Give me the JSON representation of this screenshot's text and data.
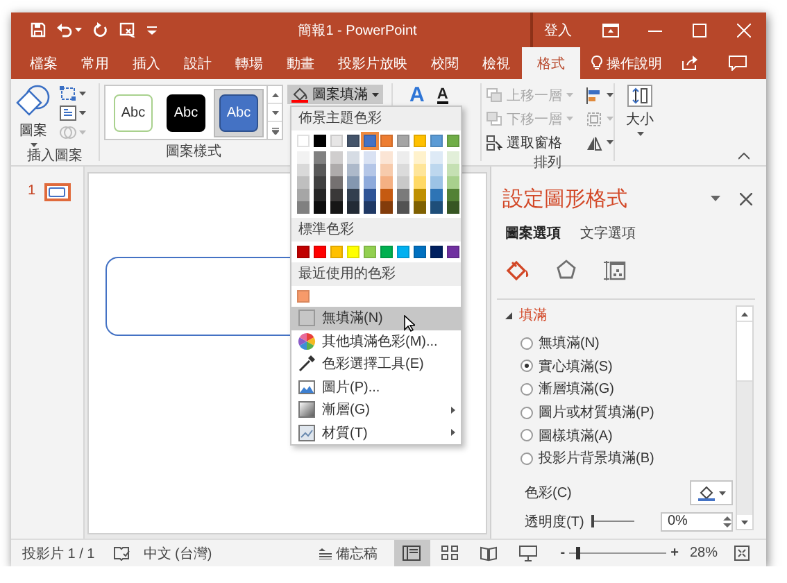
{
  "window": {
    "title": "簡報1 - PowerPoint",
    "sign_in": "登入"
  },
  "tabs": [
    {
      "label": "檔案",
      "selected": false
    },
    {
      "label": "常用",
      "selected": false
    },
    {
      "label": "插入",
      "selected": false
    },
    {
      "label": "設計",
      "selected": false
    },
    {
      "label": "轉場",
      "selected": false
    },
    {
      "label": "動畫",
      "selected": false
    },
    {
      "label": "投影片放映",
      "selected": false
    },
    {
      "label": "校閱",
      "selected": false
    },
    {
      "label": "檢視",
      "selected": false
    },
    {
      "label": "格式",
      "selected": true
    }
  ],
  "tell_me": "操作說明",
  "ribbon": {
    "insert_shapes": {
      "button": "圖案",
      "label": "插入圖案"
    },
    "shape_styles": {
      "label": "圖案樣式",
      "fill_button": "圖案填滿",
      "styles": [
        {
          "text": "Abc",
          "kind": "outline",
          "selected": false
        },
        {
          "text": "Abc",
          "kind": "dark",
          "selected": false
        },
        {
          "text": "Abc",
          "kind": "accent",
          "selected": true
        }
      ]
    },
    "wordart": {
      "quick_styles_glyph": "A",
      "text_fill_glyph": "A"
    },
    "arrange": {
      "label": "排列",
      "items": [
        {
          "label": "上移一層",
          "kind": "forward",
          "disabled": true
        },
        {
          "label": "下移一層",
          "kind": "backward",
          "disabled": true
        },
        {
          "label": "選取窗格",
          "kind": "pane",
          "disabled": false
        }
      ]
    },
    "size": {
      "button": "大小"
    }
  },
  "slides": [
    {
      "number": "1",
      "selected": true
    }
  ],
  "fill_menu": {
    "theme_header": "佈景主題色彩",
    "theme_colors": [
      {
        "color": "#ffffff",
        "selected": false,
        "shades": [
          {
            "color": "#f2f2f2"
          },
          {
            "color": "#d9d9d9"
          },
          {
            "color": "#bfbfbf"
          },
          {
            "color": "#a6a6a6"
          },
          {
            "color": "#808080"
          }
        ]
      },
      {
        "color": "#000000",
        "selected": false,
        "shades": [
          {
            "color": "#808080"
          },
          {
            "color": "#595959"
          },
          {
            "color": "#404040"
          },
          {
            "color": "#262626"
          },
          {
            "color": "#0d0d0d"
          }
        ]
      },
      {
        "color": "#e7e6e6",
        "selected": false,
        "shades": [
          {
            "color": "#d0cece"
          },
          {
            "color": "#aeabab"
          },
          {
            "color": "#757171"
          },
          {
            "color": "#3a3838"
          },
          {
            "color": "#161616"
          }
        ]
      },
      {
        "color": "#44546a",
        "selected": false,
        "shades": [
          {
            "color": "#d6dce4"
          },
          {
            "color": "#adb9ca"
          },
          {
            "color": "#8497b0"
          },
          {
            "color": "#333f4f"
          },
          {
            "color": "#222a35"
          }
        ]
      },
      {
        "color": "#4472c4",
        "selected": true,
        "shades": [
          {
            "color": "#d9e2f3"
          },
          {
            "color": "#b4c6e7"
          },
          {
            "color": "#8eaadb"
          },
          {
            "color": "#2f5496"
          },
          {
            "color": "#1f3864"
          }
        ]
      },
      {
        "color": "#ed7d31",
        "selected": false,
        "shades": [
          {
            "color": "#fbe5d5"
          },
          {
            "color": "#f7cbac"
          },
          {
            "color": "#f4b083"
          },
          {
            "color": "#c55a11"
          },
          {
            "color": "#833c0b"
          }
        ]
      },
      {
        "color": "#a5a5a5",
        "selected": false,
        "shades": [
          {
            "color": "#ededed"
          },
          {
            "color": "#dbdbdb"
          },
          {
            "color": "#c9c9c9"
          },
          {
            "color": "#7b7b7b"
          },
          {
            "color": "#525252"
          }
        ]
      },
      {
        "color": "#ffc000",
        "selected": false,
        "shades": [
          {
            "color": "#fff2cc"
          },
          {
            "color": "#fee599"
          },
          {
            "color": "#ffd965"
          },
          {
            "color": "#bf9000"
          },
          {
            "color": "#7f6000"
          }
        ]
      },
      {
        "color": "#5b9bd5",
        "selected": false,
        "shades": [
          {
            "color": "#deeaf6"
          },
          {
            "color": "#bdd7ee"
          },
          {
            "color": "#9cc3e5"
          },
          {
            "color": "#2e74b5"
          },
          {
            "color": "#1e4e79"
          }
        ]
      },
      {
        "color": "#70ad47",
        "selected": false,
        "shades": [
          {
            "color": "#e2efd9"
          },
          {
            "color": "#c5e0b3"
          },
          {
            "color": "#a8d08d"
          },
          {
            "color": "#538135"
          },
          {
            "color": "#375623"
          }
        ]
      }
    ],
    "standard_header": "標準色彩",
    "standard_colors": [
      {
        "color": "#c00000"
      },
      {
        "color": "#ff0000"
      },
      {
        "color": "#ffc000"
      },
      {
        "color": "#ffff00"
      },
      {
        "color": "#92d050"
      },
      {
        "color": "#00b050"
      },
      {
        "color": "#00b0f0"
      },
      {
        "color": "#0070c0"
      },
      {
        "color": "#002060"
      },
      {
        "color": "#7030a0"
      }
    ],
    "recent_header": "最近使用的色彩",
    "recent_colors": [
      {
        "color": "#f79a6a"
      }
    ],
    "items": [
      {
        "label": "無填滿(N)",
        "kind": "none",
        "highlighted": true,
        "submenu": false
      },
      {
        "label": "其他填滿色彩(M)...",
        "kind": "more",
        "highlighted": false,
        "submenu": false
      },
      {
        "label": "色彩選擇工具(E)",
        "kind": "eyedropper",
        "highlighted": false,
        "submenu": false
      },
      {
        "label": "圖片(P)...",
        "kind": "picture",
        "highlighted": false,
        "submenu": false
      },
      {
        "label": "漸層(G)",
        "kind": "gradient",
        "highlighted": false,
        "submenu": true
      },
      {
        "label": "材質(T)",
        "kind": "texture",
        "highlighted": false,
        "submenu": true
      }
    ]
  },
  "format_pane": {
    "title": "設定圖形格式",
    "tabs": [
      {
        "label": "圖案選項",
        "selected": true
      },
      {
        "label": "文字選項",
        "selected": false
      }
    ],
    "icon_tabs": [
      {
        "kind": "fill",
        "selected": true
      },
      {
        "kind": "effects",
        "selected": false
      },
      {
        "kind": "size",
        "selected": false
      }
    ],
    "section": {
      "title": "填滿",
      "expanded": true
    },
    "fill_options": [
      {
        "label": "無填滿(N)",
        "selected": false
      },
      {
        "label": "實心填滿(S)",
        "selected": true
      },
      {
        "label": "漸層填滿(G)",
        "selected": false
      },
      {
        "label": "圖片或材質填滿(P)",
        "selected": false
      },
      {
        "label": "圖樣填滿(A)",
        "selected": false
      },
      {
        "label": "投影片背景填滿(B)",
        "selected": false
      }
    ],
    "color_label": "色彩(C)",
    "transparency": {
      "label": "透明度(T)",
      "level": 0,
      "value": "0%"
    }
  },
  "status_bar": {
    "slide": "投影片 1 / 1",
    "language": "中文 (台灣)",
    "notes": "備忘稿",
    "views": [
      {
        "kind": "normal",
        "selected": true
      },
      {
        "kind": "sorter",
        "selected": false
      },
      {
        "kind": "reading",
        "selected": false
      },
      {
        "kind": "slideshow",
        "selected": false
      }
    ],
    "zoom_out": "-",
    "zoom_in": "+",
    "zoom": {
      "level": 0.08
    },
    "zoom_value": "28%"
  }
}
